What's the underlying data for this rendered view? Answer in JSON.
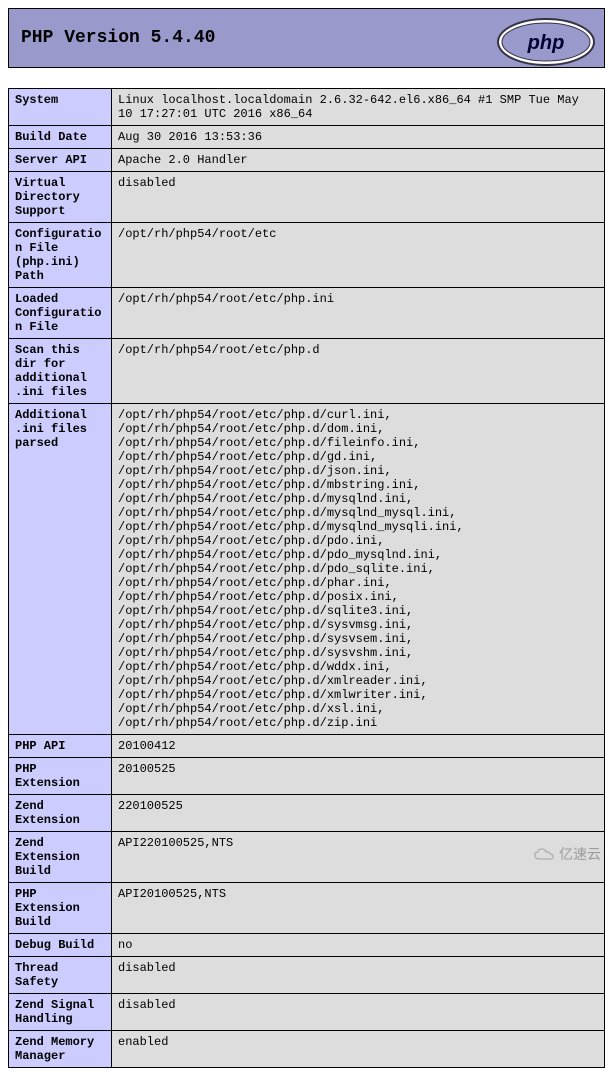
{
  "header": {
    "title": "PHP Version 5.4.40"
  },
  "rows": [
    {
      "key": "System",
      "val": "Linux localhost.localdomain 2.6.32-642.el6.x86_64 #1 SMP Tue May 10 17:27:01 UTC 2016 x86_64"
    },
    {
      "key": "Build Date",
      "val": "Aug 30 2016 13:53:36"
    },
    {
      "key": "Server API",
      "val": "Apache 2.0 Handler"
    },
    {
      "key": "Virtual Directory Support",
      "val": "disabled"
    },
    {
      "key": "Configuration File (php.ini) Path",
      "val": "/opt/rh/php54/root/etc"
    },
    {
      "key": "Loaded Configuration File",
      "val": "/opt/rh/php54/root/etc/php.ini"
    },
    {
      "key": "Scan this dir for additional .ini files",
      "val": "/opt/rh/php54/root/etc/php.d"
    },
    {
      "key": "Additional .ini files parsed",
      "val": "/opt/rh/php54/root/etc/php.d/curl.ini, /opt/rh/php54/root/etc/php.d/dom.ini, /opt/rh/php54/root/etc/php.d/fileinfo.ini, /opt/rh/php54/root/etc/php.d/gd.ini, /opt/rh/php54/root/etc/php.d/json.ini, /opt/rh/php54/root/etc/php.d/mbstring.ini, /opt/rh/php54/root/etc/php.d/mysqlnd.ini, /opt/rh/php54/root/etc/php.d/mysqlnd_mysql.ini, /opt/rh/php54/root/etc/php.d/mysqlnd_mysqli.ini, /opt/rh/php54/root/etc/php.d/pdo.ini, /opt/rh/php54/root/etc/php.d/pdo_mysqlnd.ini, /opt/rh/php54/root/etc/php.d/pdo_sqlite.ini, /opt/rh/php54/root/etc/php.d/phar.ini, /opt/rh/php54/root/etc/php.d/posix.ini, /opt/rh/php54/root/etc/php.d/sqlite3.ini, /opt/rh/php54/root/etc/php.d/sysvmsg.ini, /opt/rh/php54/root/etc/php.d/sysvsem.ini, /opt/rh/php54/root/etc/php.d/sysvshm.ini, /opt/rh/php54/root/etc/php.d/wddx.ini, /opt/rh/php54/root/etc/php.d/xmlreader.ini, /opt/rh/php54/root/etc/php.d/xmlwriter.ini, /opt/rh/php54/root/etc/php.d/xsl.ini, /opt/rh/php54/root/etc/php.d/zip.ini"
    },
    {
      "key": "PHP API",
      "val": "20100412"
    },
    {
      "key": "PHP Extension",
      "val": "20100525"
    },
    {
      "key": "Zend Extension",
      "val": "220100525"
    },
    {
      "key": "Zend Extension Build",
      "val": "API220100525,NTS"
    },
    {
      "key": "PHP Extension Build",
      "val": "API20100525,NTS"
    },
    {
      "key": "Debug Build",
      "val": "no"
    },
    {
      "key": "Thread Safety",
      "val": "disabled"
    },
    {
      "key": "Zend Signal Handling",
      "val": "disabled"
    },
    {
      "key": "Zend Memory Manager",
      "val": "enabled"
    }
  ],
  "watermark": {
    "text": "亿速云"
  }
}
